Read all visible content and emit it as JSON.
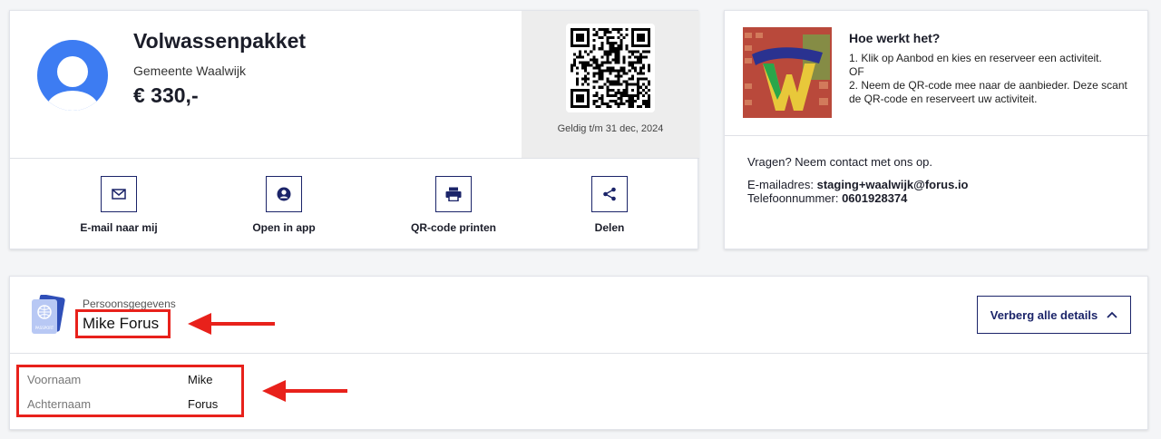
{
  "voucher": {
    "title": "Volwassenpakket",
    "organization": "Gemeente Waalwijk",
    "amount": "€ 330,-",
    "valid_until": "Geldig t/m 31 dec, 2024",
    "actions": [
      {
        "label": "E-mail naar mij",
        "icon": "mail-icon"
      },
      {
        "label": "Open in app",
        "icon": "user-circle-icon"
      },
      {
        "label": "QR-code printen",
        "icon": "printer-icon"
      },
      {
        "label": "Delen",
        "icon": "share-icon"
      }
    ]
  },
  "info": {
    "title": "Hoe werkt het?",
    "line1": "1. Klik op Aanbod en kies en reserveer een activiteit.",
    "line2": "OF",
    "line3": "2. Neem de QR-code mee naar de aanbieder. Deze scant de QR-code en reserveert uw activiteit.",
    "question": "Vragen? Neem contact met ons op.",
    "email_label": "E-mailadres:",
    "email_value": "staging+waalwijk@forus.io",
    "phone_label": "Telefoonnummer:",
    "phone_value": "0601928374"
  },
  "person": {
    "section_label": "Persoonsgegevens",
    "name": "Mike Forus",
    "hide_button": "Verberg alle details",
    "passport_text": "PASSPORT",
    "rows": [
      {
        "label": "Voornaam",
        "value": "Mike"
      },
      {
        "label": "Achternaam",
        "value": "Forus"
      }
    ]
  },
  "colors": {
    "accent": "#1b2469",
    "avatar": "#3d7cf2",
    "highlight": "#e8211b"
  }
}
